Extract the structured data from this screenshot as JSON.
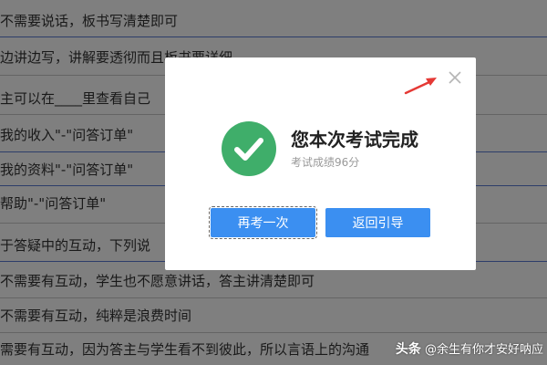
{
  "background_rows": [
    "不需要说话，板书写清楚即可",
    "边讲边写，讲解要透彻而且板书要详细",
    "主可以在____里查看自己",
    "我的收入\"-\"问答订单\"",
    "我的资料\"-\"问答订单\"",
    "帮助\"-\"问答订单\"",
    "于答疑中的互动，下列说",
    "不需要有互动，学生也不愿意讲话，答主讲清楚即可",
    "不需要有互动，纯粹是浪费时间",
    "需要有互动，因为答主与学生看不到彼此，所以言语上的沟通"
  ],
  "modal": {
    "title": "您本次考试完成",
    "score": "考试成绩96分",
    "retry_label": "再考一次",
    "back_label": "返回引导"
  },
  "icons": {
    "success": "check-circle-icon",
    "close": "close-icon",
    "annotation": "red-arrow-icon"
  },
  "colors": {
    "success": "#3fae6a",
    "button": "#3b8ff1",
    "arrow": "#e53935",
    "overlay": "rgba(0,0,0,0.5)"
  },
  "watermark": {
    "brand": "头条",
    "handle": "@余生有你才安好呐应"
  }
}
